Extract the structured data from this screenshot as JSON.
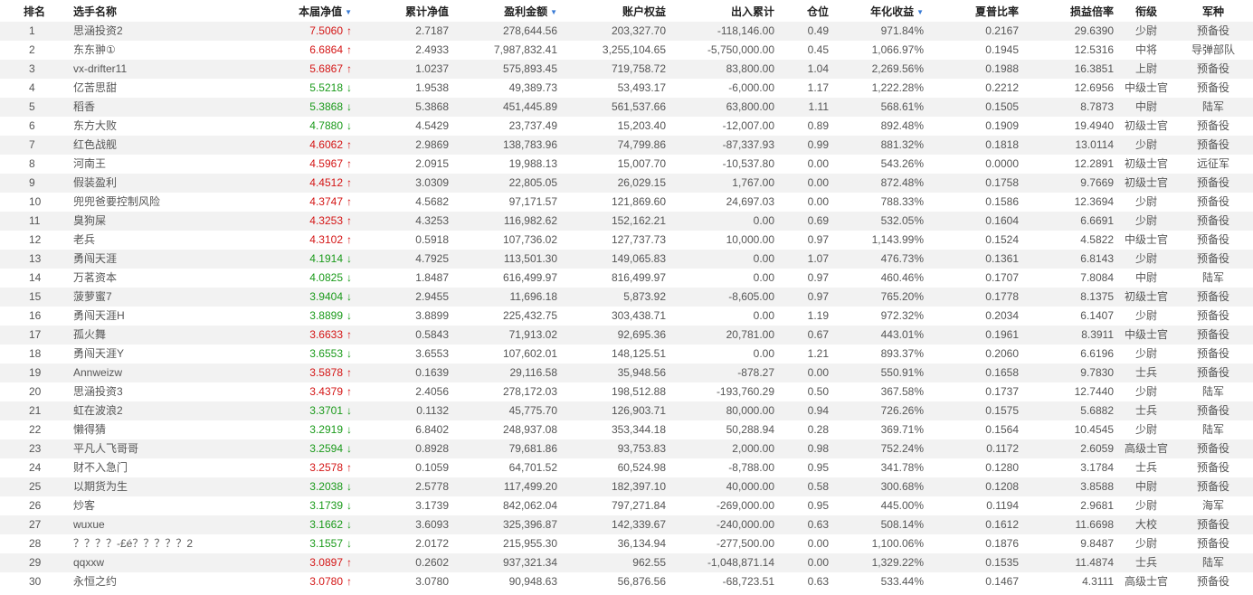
{
  "header": {
    "rank": "排名",
    "name": "选手名称",
    "nav": "本届净值",
    "cum_nav": "累计净值",
    "profit": "盈利金额",
    "equity": "账户权益",
    "inout": "出入累计",
    "position": "仓位",
    "annual": "年化收益",
    "sharpe": "夏普比率",
    "pl_ratio": "损益倍率",
    "rank_title": "衔级",
    "branch": "军种"
  },
  "sort_icon": "sort-down-triangle",
  "colors": {
    "up": "#d41515",
    "down": "#1a9a1a",
    "sort": "#3a7bd5",
    "stripe": "#f2f2f2"
  },
  "rows": [
    {
      "rank": "1",
      "name": "思涵投资2",
      "nav": "7.5060",
      "dir": "up",
      "cum": "2.7187",
      "profit": "278,644.56",
      "equity": "203,327.70",
      "inout": "-118,146.00",
      "pos": "0.49",
      "annual": "971.84%",
      "sharpe": "0.2167",
      "pl": "29.6390",
      "title": "少尉",
      "branch": "预备役"
    },
    {
      "rank": "2",
      "name": "东东翀①",
      "nav": "6.6864",
      "dir": "up",
      "cum": "2.4933",
      "profit": "7,987,832.41",
      "equity": "3,255,104.65",
      "inout": "-5,750,000.00",
      "pos": "0.45",
      "annual": "1,066.97%",
      "sharpe": "0.1945",
      "pl": "12.5316",
      "title": "中将",
      "branch": "导弹部队"
    },
    {
      "rank": "3",
      "name": "vx-drifter11",
      "nav": "5.6867",
      "dir": "up",
      "cum": "1.0237",
      "profit": "575,893.45",
      "equity": "719,758.72",
      "inout": "83,800.00",
      "pos": "1.04",
      "annual": "2,269.56%",
      "sharpe": "0.1988",
      "pl": "16.3851",
      "title": "上尉",
      "branch": "预备役"
    },
    {
      "rank": "4",
      "name": "亿苦思甜",
      "nav": "5.5218",
      "dir": "down",
      "cum": "1.9538",
      "profit": "49,389.73",
      "equity": "53,493.17",
      "inout": "-6,000.00",
      "pos": "1.17",
      "annual": "1,222.28%",
      "sharpe": "0.2212",
      "pl": "12.6956",
      "title": "中级士官",
      "branch": "预备役"
    },
    {
      "rank": "5",
      "name": "稻香",
      "nav": "5.3868",
      "dir": "down",
      "cum": "5.3868",
      "profit": "451,445.89",
      "equity": "561,537.66",
      "inout": "63,800.00",
      "pos": "1.11",
      "annual": "568.61%",
      "sharpe": "0.1505",
      "pl": "8.7873",
      "title": "中尉",
      "branch": "陆军"
    },
    {
      "rank": "6",
      "name": "东方大败",
      "nav": "4.7880",
      "dir": "down",
      "cum": "4.5429",
      "profit": "23,737.49",
      "equity": "15,203.40",
      "inout": "-12,007.00",
      "pos": "0.89",
      "annual": "892.48%",
      "sharpe": "0.1909",
      "pl": "19.4940",
      "title": "初级士官",
      "branch": "预备役"
    },
    {
      "rank": "7",
      "name": "红色战舰",
      "nav": "4.6062",
      "dir": "up",
      "cum": "2.9869",
      "profit": "138,783.96",
      "equity": "74,799.86",
      "inout": "-87,337.93",
      "pos": "0.99",
      "annual": "881.32%",
      "sharpe": "0.1818",
      "pl": "13.0114",
      "title": "少尉",
      "branch": "预备役"
    },
    {
      "rank": "8",
      "name": "河南王",
      "nav": "4.5967",
      "dir": "up",
      "cum": "2.0915",
      "profit": "19,988.13",
      "equity": "15,007.70",
      "inout": "-10,537.80",
      "pos": "0.00",
      "annual": "543.26%",
      "sharpe": "0.0000",
      "pl": "12.2891",
      "title": "初级士官",
      "branch": "远征军"
    },
    {
      "rank": "9",
      "name": "假装盈利",
      "nav": "4.4512",
      "dir": "up",
      "cum": "3.0309",
      "profit": "22,805.05",
      "equity": "26,029.15",
      "inout": "1,767.00",
      "pos": "0.00",
      "annual": "872.48%",
      "sharpe": "0.1758",
      "pl": "9.7669",
      "title": "初级士官",
      "branch": "预备役"
    },
    {
      "rank": "10",
      "name": "兜兜爸要控制风险",
      "nav": "4.3747",
      "dir": "up",
      "cum": "4.5682",
      "profit": "97,171.57",
      "equity": "121,869.60",
      "inout": "24,697.03",
      "pos": "0.00",
      "annual": "788.33%",
      "sharpe": "0.1586",
      "pl": "12.3694",
      "title": "少尉",
      "branch": "预备役"
    },
    {
      "rank": "11",
      "name": "臭狗屎",
      "nav": "4.3253",
      "dir": "up",
      "cum": "4.3253",
      "profit": "116,982.62",
      "equity": "152,162.21",
      "inout": "0.00",
      "pos": "0.69",
      "annual": "532.05%",
      "sharpe": "0.1604",
      "pl": "6.6691",
      "title": "少尉",
      "branch": "预备役"
    },
    {
      "rank": "12",
      "name": "老兵",
      "nav": "4.3102",
      "dir": "up",
      "cum": "0.5918",
      "profit": "107,736.02",
      "equity": "127,737.73",
      "inout": "10,000.00",
      "pos": "0.97",
      "annual": "1,143.99%",
      "sharpe": "0.1524",
      "pl": "4.5822",
      "title": "中级士官",
      "branch": "预备役"
    },
    {
      "rank": "13",
      "name": "勇闯天涯",
      "nav": "4.1914",
      "dir": "down",
      "cum": "4.7925",
      "profit": "113,501.30",
      "equity": "149,065.83",
      "inout": "0.00",
      "pos": "1.07",
      "annual": "476.73%",
      "sharpe": "0.1361",
      "pl": "6.8143",
      "title": "少尉",
      "branch": "预备役"
    },
    {
      "rank": "14",
      "name": "万茗资本",
      "nav": "4.0825",
      "dir": "down",
      "cum": "1.8487",
      "profit": "616,499.97",
      "equity": "816,499.97",
      "inout": "0.00",
      "pos": "0.97",
      "annual": "460.46%",
      "sharpe": "0.1707",
      "pl": "7.8084",
      "title": "中尉",
      "branch": "陆军"
    },
    {
      "rank": "15",
      "name": "菠萝蜜7",
      "nav": "3.9404",
      "dir": "down",
      "cum": "2.9455",
      "profit": "11,696.18",
      "equity": "5,873.92",
      "inout": "-8,605.00",
      "pos": "0.97",
      "annual": "765.20%",
      "sharpe": "0.1778",
      "pl": "8.1375",
      "title": "初级士官",
      "branch": "预备役"
    },
    {
      "rank": "16",
      "name": "勇闯天涯H",
      "nav": "3.8899",
      "dir": "down",
      "cum": "3.8899",
      "profit": "225,432.75",
      "equity": "303,438.71",
      "inout": "0.00",
      "pos": "1.19",
      "annual": "972.32%",
      "sharpe": "0.2034",
      "pl": "6.1407",
      "title": "少尉",
      "branch": "预备役"
    },
    {
      "rank": "17",
      "name": "孤火舞",
      "nav": "3.6633",
      "dir": "up",
      "cum": "0.5843",
      "profit": "71,913.02",
      "equity": "92,695.36",
      "inout": "20,781.00",
      "pos": "0.67",
      "annual": "443.01%",
      "sharpe": "0.1961",
      "pl": "8.3911",
      "title": "中级士官",
      "branch": "预备役"
    },
    {
      "rank": "18",
      "name": "勇闯天涯Y",
      "nav": "3.6553",
      "dir": "down",
      "cum": "3.6553",
      "profit": "107,602.01",
      "equity": "148,125.51",
      "inout": "0.00",
      "pos": "1.21",
      "annual": "893.37%",
      "sharpe": "0.2060",
      "pl": "6.6196",
      "title": "少尉",
      "branch": "预备役"
    },
    {
      "rank": "19",
      "name": "Annweizw",
      "nav": "3.5878",
      "dir": "up",
      "cum": "0.1639",
      "profit": "29,116.58",
      "equity": "35,948.56",
      "inout": "-878.27",
      "pos": "0.00",
      "annual": "550.91%",
      "sharpe": "0.1658",
      "pl": "9.7830",
      "title": "士兵",
      "branch": "预备役"
    },
    {
      "rank": "20",
      "name": "思涵投资3",
      "nav": "3.4379",
      "dir": "up",
      "cum": "2.4056",
      "profit": "278,172.03",
      "equity": "198,512.88",
      "inout": "-193,760.29",
      "pos": "0.50",
      "annual": "367.58%",
      "sharpe": "0.1737",
      "pl": "12.7440",
      "title": "少尉",
      "branch": "陆军"
    },
    {
      "rank": "21",
      "name": "虹在波浪2",
      "nav": "3.3701",
      "dir": "down",
      "cum": "0.1132",
      "profit": "45,775.70",
      "equity": "126,903.71",
      "inout": "80,000.00",
      "pos": "0.94",
      "annual": "726.26%",
      "sharpe": "0.1575",
      "pl": "5.6882",
      "title": "士兵",
      "branch": "预备役"
    },
    {
      "rank": "22",
      "name": "懒得猜",
      "nav": "3.2919",
      "dir": "down",
      "cum": "6.8402",
      "profit": "248,937.08",
      "equity": "353,344.18",
      "inout": "50,288.94",
      "pos": "0.28",
      "annual": "369.71%",
      "sharpe": "0.1564",
      "pl": "10.4545",
      "title": "少尉",
      "branch": "陆军"
    },
    {
      "rank": "23",
      "name": "平凡人飞哥哥",
      "nav": "3.2594",
      "dir": "down",
      "cum": "0.8928",
      "profit": "79,681.86",
      "equity": "93,753.83",
      "inout": "2,000.00",
      "pos": "0.98",
      "annual": "752.24%",
      "sharpe": "0.1172",
      "pl": "2.6059",
      "title": "高级士官",
      "branch": "预备役"
    },
    {
      "rank": "24",
      "name": "财不入急门",
      "nav": "3.2578",
      "dir": "up",
      "cum": "0.1059",
      "profit": "64,701.52",
      "equity": "60,524.98",
      "inout": "-8,788.00",
      "pos": "0.95",
      "annual": "341.78%",
      "sharpe": "0.1280",
      "pl": "3.1784",
      "title": "士兵",
      "branch": "预备役"
    },
    {
      "rank": "25",
      "name": "以期货为生",
      "nav": "3.2038",
      "dir": "down",
      "cum": "2.5778",
      "profit": "117,499.20",
      "equity": "182,397.10",
      "inout": "40,000.00",
      "pos": "0.58",
      "annual": "300.68%",
      "sharpe": "0.1208",
      "pl": "3.8588",
      "title": "中尉",
      "branch": "预备役"
    },
    {
      "rank": "26",
      "name": "炒客",
      "nav": "3.1739",
      "dir": "down",
      "cum": "3.1739",
      "profit": "842,062.04",
      "equity": "797,271.84",
      "inout": "-269,000.00",
      "pos": "0.95",
      "annual": "445.00%",
      "sharpe": "0.1194",
      "pl": "2.9681",
      "title": "少尉",
      "branch": "海军"
    },
    {
      "rank": "27",
      "name": "wuxue",
      "nav": "3.1662",
      "dir": "down",
      "cum": "3.6093",
      "profit": "325,396.87",
      "equity": "142,339.67",
      "inout": "-240,000.00",
      "pos": "0.63",
      "annual": "508.14%",
      "sharpe": "0.1612",
      "pl": "11.6698",
      "title": "大校",
      "branch": "预备役"
    },
    {
      "rank": "28",
      "name": "？？？？-£é？？？？？2",
      "nav": "3.1557",
      "dir": "down",
      "cum": "2.0172",
      "profit": "215,955.30",
      "equity": "36,134.94",
      "inout": "-277,500.00",
      "pos": "0.00",
      "annual": "1,100.06%",
      "sharpe": "0.1876",
      "pl": "9.8487",
      "title": "少尉",
      "branch": "预备役"
    },
    {
      "rank": "29",
      "name": "qqxxw",
      "nav": "3.0897",
      "dir": "up",
      "cum": "0.2602",
      "profit": "937,321.34",
      "equity": "962.55",
      "inout": "-1,048,871.14",
      "pos": "0.00",
      "annual": "1,329.22%",
      "sharpe": "0.1535",
      "pl": "11.4874",
      "title": "士兵",
      "branch": "陆军"
    },
    {
      "rank": "30",
      "name": "永恒之约",
      "nav": "3.0780",
      "dir": "up",
      "cum": "3.0780",
      "profit": "90,948.63",
      "equity": "56,876.56",
      "inout": "-68,723.51",
      "pos": "0.63",
      "annual": "533.44%",
      "sharpe": "0.1467",
      "pl": "4.3111",
      "title": "高级士官",
      "branch": "预备役"
    }
  ]
}
